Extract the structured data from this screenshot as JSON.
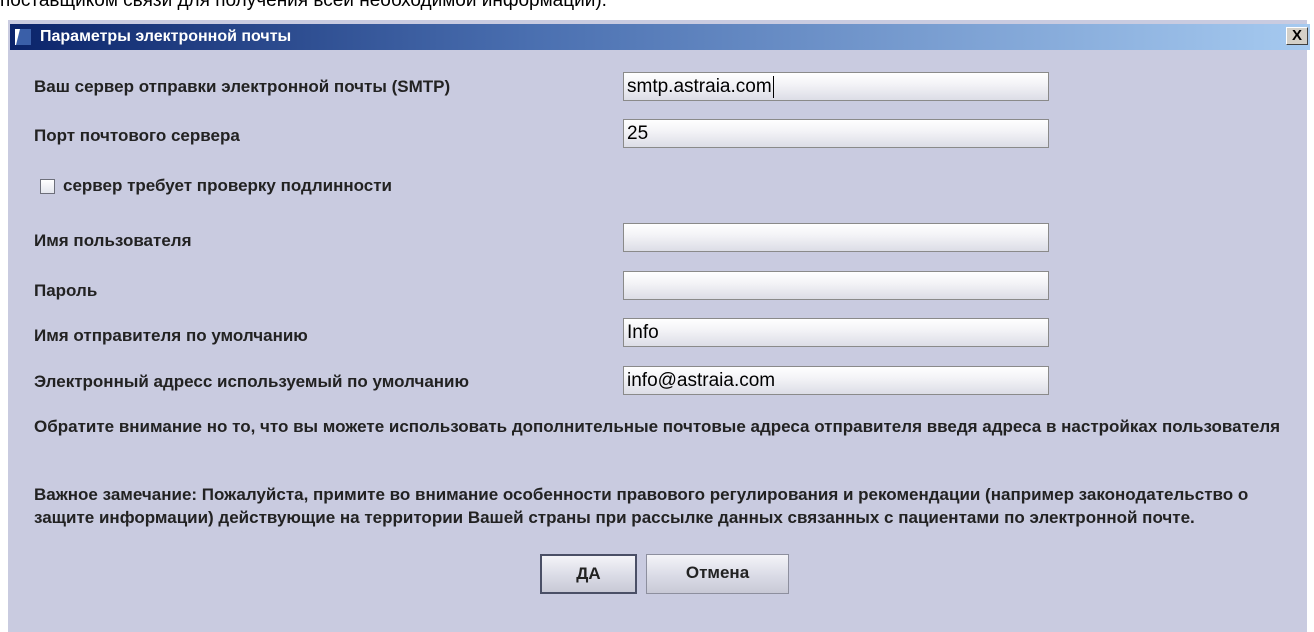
{
  "background_text": "поставщиком связи для получения всей необходимой информации).",
  "dialog": {
    "title": "Параметры электронной почты",
    "close_label": "X"
  },
  "form": {
    "smtp_label": "Ваш сервер отправки электронной почты (SMTP)",
    "smtp_value": "smtp.astraia.com",
    "port_label": "Порт почтового сервера",
    "port_value": "25",
    "auth_label": "сервер требует проверку подлинности",
    "auth_checked": false,
    "username_label": "Имя пользователя",
    "username_value": "",
    "password_label": "Пароль",
    "password_value": "",
    "sender_label": "Имя отправителя по умолчанию",
    "sender_value": "Info",
    "email_label": "Электронный адресс используемый по умолчанию",
    "email_value": "info@astraia.com"
  },
  "notes": {
    "note1": "Обратите внимание но то, что вы можете использовать дополнительные почтовые адреса отправителя введя адреса в настройках пользователя",
    "note2": "Важное замечание: Пожалуйста, примите во внимание особенности правового регулирования и рекомендации (например законодательство о защите информации) действующие на территории Вашей страны при рассылке данных связанных с пациентами по электронной почте."
  },
  "buttons": {
    "ok_label": "ДА",
    "cancel_label": "Отмена"
  },
  "colors": {
    "dialog_bg": "#c9cbe0",
    "title_start": "#0b246a",
    "title_end": "#a6caf0"
  }
}
